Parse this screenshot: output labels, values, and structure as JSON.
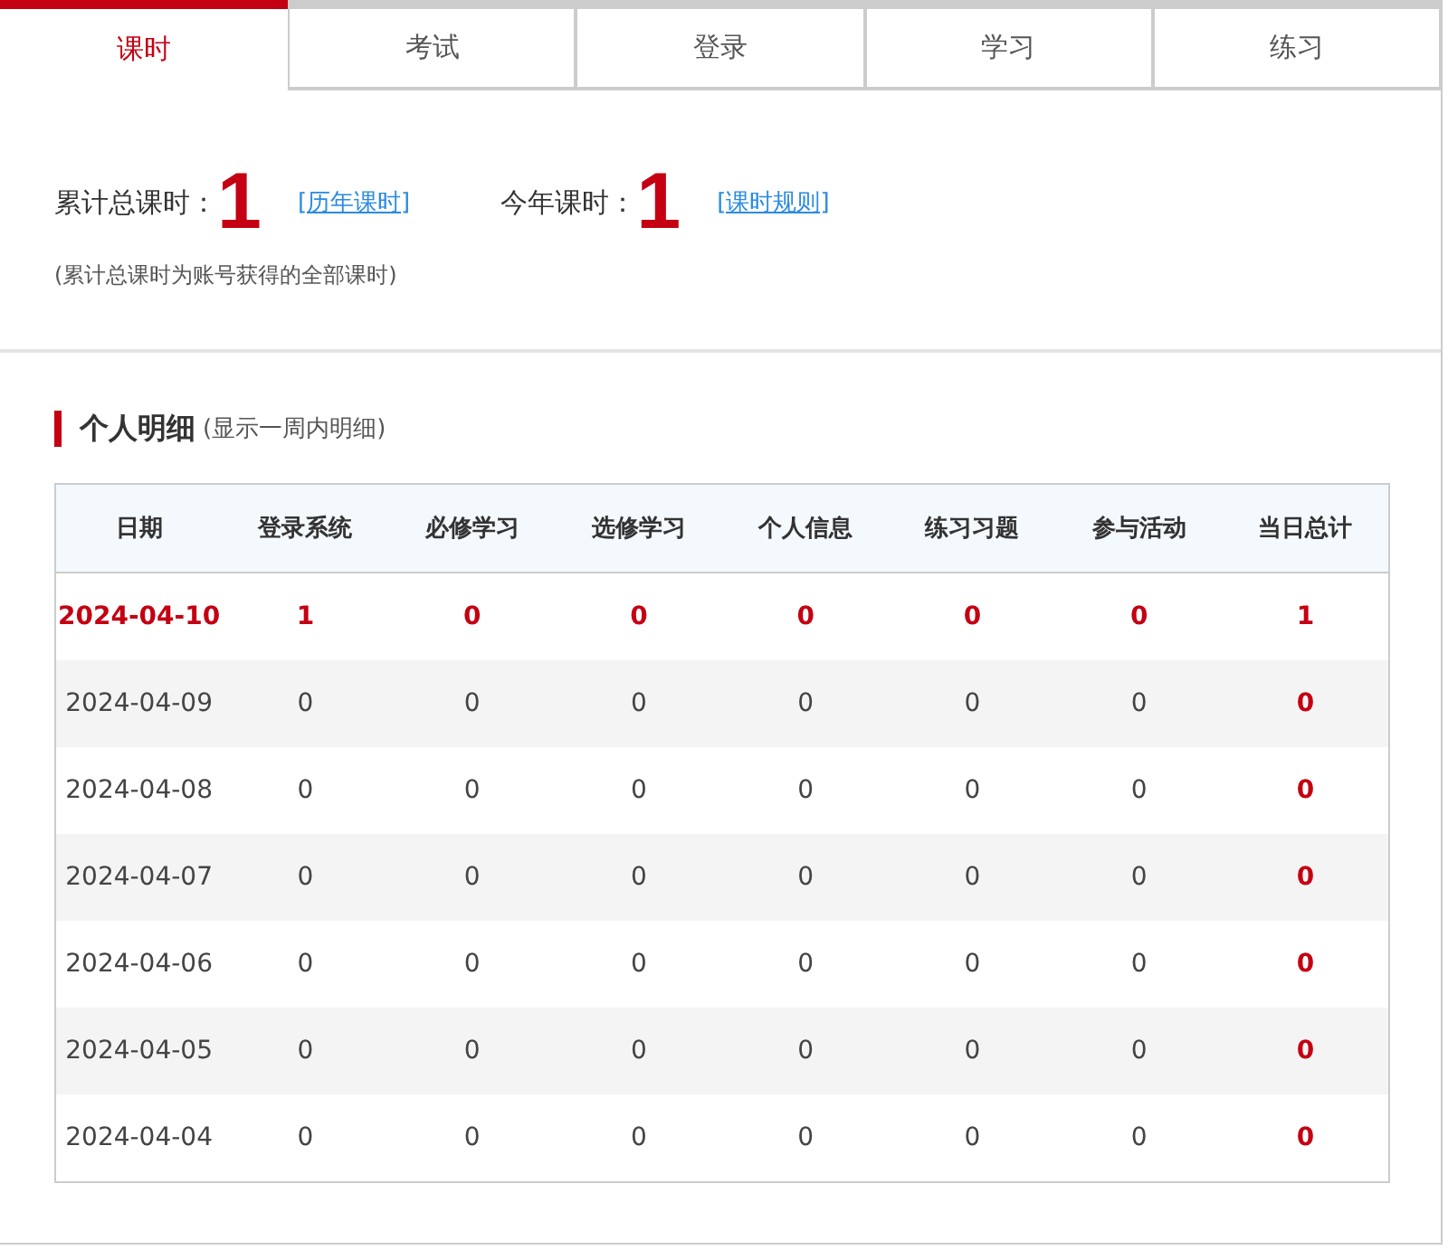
{
  "tabs": [
    {
      "label": "课时",
      "selected": true
    },
    {
      "label": "考试",
      "selected": false
    },
    {
      "label": "登录",
      "selected": false
    },
    {
      "label": "学习",
      "selected": false
    },
    {
      "label": "练习",
      "selected": false
    }
  ],
  "summary": {
    "total_label": "累计总课时：",
    "total_value": "1",
    "history_link": "[历年课时]",
    "year_label": "今年课时：",
    "year_value": "1",
    "rules_link": "[课时规则]",
    "note": "(累计总课时为账号获得的全部课时)"
  },
  "detail": {
    "title": "个人明细",
    "subtitle": "(显示一周内明细)",
    "columns": [
      "日期",
      "登录系统",
      "必修学习",
      "选修学习",
      "个人信息",
      "练习习题",
      "参与活动",
      "当日总计"
    ],
    "rows": [
      {
        "today": true,
        "cells": [
          "2024-04-10",
          "1",
          "0",
          "0",
          "0",
          "0",
          "0",
          "1"
        ]
      },
      {
        "today": false,
        "cells": [
          "2024-04-09",
          "0",
          "0",
          "0",
          "0",
          "0",
          "0",
          "0"
        ]
      },
      {
        "today": false,
        "cells": [
          "2024-04-08",
          "0",
          "0",
          "0",
          "0",
          "0",
          "0",
          "0"
        ]
      },
      {
        "today": false,
        "cells": [
          "2024-04-07",
          "0",
          "0",
          "0",
          "0",
          "0",
          "0",
          "0"
        ]
      },
      {
        "today": false,
        "cells": [
          "2024-04-06",
          "0",
          "0",
          "0",
          "0",
          "0",
          "0",
          "0"
        ]
      },
      {
        "today": false,
        "cells": [
          "2024-04-05",
          "0",
          "0",
          "0",
          "0",
          "0",
          "0",
          "0"
        ]
      },
      {
        "today": false,
        "cells": [
          "2024-04-04",
          "0",
          "0",
          "0",
          "0",
          "0",
          "0",
          "0"
        ]
      }
    ]
  }
}
